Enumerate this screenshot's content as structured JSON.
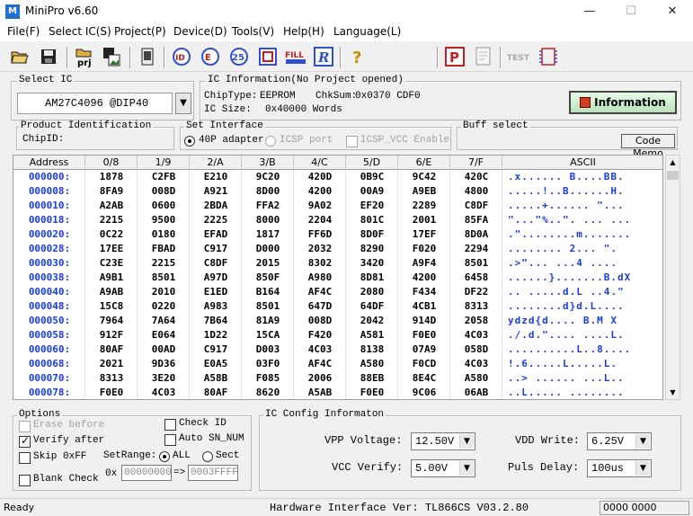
{
  "window": {
    "title": "MiniPro v6.60",
    "min": "—",
    "max": "☐",
    "close": "✕"
  },
  "menu": [
    "File(F)",
    "Select IC(S)",
    "Project(P)",
    "Device(D)",
    "Tools(V)",
    "Help(H)",
    "Language(L)"
  ],
  "select_ic": {
    "label": "Select IC",
    "value": "AM27C4096   @DIP40"
  },
  "ic_info": {
    "label": "IC Information(No Project opened)",
    "chip_type_label": "ChipType:",
    "chip_type": "EEPROM",
    "chksum_label": "ChkSum:",
    "chksum": "0x0370 CDF0",
    "ic_size_label": "IC Size:",
    "ic_size": "0x40000 Words",
    "info_button": "Information"
  },
  "product_id": {
    "label": "Product Identification",
    "chip_id": "ChipID:"
  },
  "interface": {
    "label": "Set Interface",
    "opt1": "40P adapter",
    "opt2": "ICSP port",
    "opt3": "ICSP_VCC Enable"
  },
  "buff": {
    "label": "Buff select",
    "code_memo": "Code Memo"
  },
  "grid": {
    "headers": [
      "Address",
      "0/8",
      "1/9",
      "2/A",
      "3/B",
      "4/C",
      "5/D",
      "6/E",
      "7/F",
      "ASCII"
    ],
    "rows": [
      [
        "000000:",
        "1878",
        "C2FB",
        "E210",
        "9C20",
        "420D",
        "0B9C",
        "9C42",
        "420C",
        ".x...... B....BB."
      ],
      [
        "000008:",
        "8FA9",
        "008D",
        "A921",
        "8D00",
        "4200",
        "00A9",
        "A9EB",
        "4800",
        ".....!..B......H."
      ],
      [
        "000010:",
        "A2AB",
        "0600",
        "2BDA",
        "FFA2",
        "9A02",
        "EF20",
        "2289",
        "C8DF",
        ".....+...... \"..."
      ],
      [
        "000018:",
        "2215",
        "9500",
        "2225",
        "8000",
        "2204",
        "801C",
        "2001",
        "85FA",
        "\"...\"%..\". ... ..."
      ],
      [
        "000020:",
        "0C22",
        "0180",
        "EFAD",
        "1817",
        "FF6D",
        "8D0F",
        "17EF",
        "8D0A",
        ".\"........m......."
      ],
      [
        "000028:",
        "17EE",
        "FBAD",
        "C917",
        "D000",
        "2032",
        "8290",
        "F020",
        "2294",
        "........ 2... \"."
      ],
      [
        "000030:",
        "C23E",
        "2215",
        "C8DF",
        "2015",
        "8302",
        "3420",
        "A9F4",
        "8501",
        ".>\"... ...4 ...."
      ],
      [
        "000038:",
        "A9B1",
        "8501",
        "A97D",
        "850F",
        "A980",
        "8D81",
        "4200",
        "6458",
        "......}.......B.dX"
      ],
      [
        "000040:",
        "A9AB",
        "2010",
        "E1ED",
        "B164",
        "AF4C",
        "2080",
        "F434",
        "DF22",
        ".. .....d.L ..4.\""
      ],
      [
        "000048:",
        "15C8",
        "0220",
        "A983",
        "8501",
        "647D",
        "64DF",
        "4CB1",
        "8313",
        "........d}d.L...."
      ],
      [
        "000050:",
        "7964",
        "7A64",
        "7B64",
        "81A9",
        "008D",
        "2042",
        "914D",
        "2058",
        "ydzd{d.... B.M X"
      ],
      [
        "000058:",
        "912F",
        "E064",
        "1D22",
        "15CA",
        "F420",
        "A581",
        "F0E0",
        "4C03",
        "./.d.\".... ....L."
      ],
      [
        "000060:",
        "80AF",
        "00AD",
        "C917",
        "D003",
        "4C03",
        "8138",
        "07A9",
        "058D",
        "..........L..8...."
      ],
      [
        "000068:",
        "2021",
        "9D36",
        "E0A5",
        "03F0",
        "AF4C",
        "A580",
        "F0CD",
        "4C03",
        " !.6.....L.....L."
      ],
      [
        "000070:",
        "8313",
        "3E20",
        "A58B",
        "F085",
        "2006",
        "88EB",
        "8E4C",
        "A580",
        "..> ...... ...L.."
      ],
      [
        "000078:",
        "F0E0",
        "4C03",
        "80AF",
        "8620",
        "A5AB",
        "F0E0",
        "9C06",
        "06AB",
        "..L..... ........"
      ]
    ]
  },
  "options": {
    "label": "Options",
    "erase_before": "Erase before",
    "verify_after": "Verify after",
    "skip_0xff": "Skip 0xFF",
    "blank_check": "Blank Check",
    "check_id": "Check ID",
    "auto_sn": "Auto SN_NUM",
    "setrange": "SetRange:",
    "all": "ALL",
    "sect": "Sect",
    "ox": "0x",
    "range_start": "00000000",
    "arrow": "=>",
    "range_end": "0003FFFF"
  },
  "ic_config": {
    "label": "IC Config Informaton",
    "vpp_label": "VPP Voltage:",
    "vpp": "12.50V",
    "vdd_label": "VDD Write:",
    "vdd": "6.25V",
    "vcc_label": "VCC Verify:",
    "vcc": "5.00V",
    "puls_label": "Puls Delay:",
    "puls": "100us"
  },
  "status": {
    "ready": "Ready",
    "hw": "Hardware Interface Ver: TL866CS V03.2.80",
    "count": "0000 0000"
  },
  "colors": {
    "address": "#1a3de0",
    "info_red": "#b01010"
  }
}
